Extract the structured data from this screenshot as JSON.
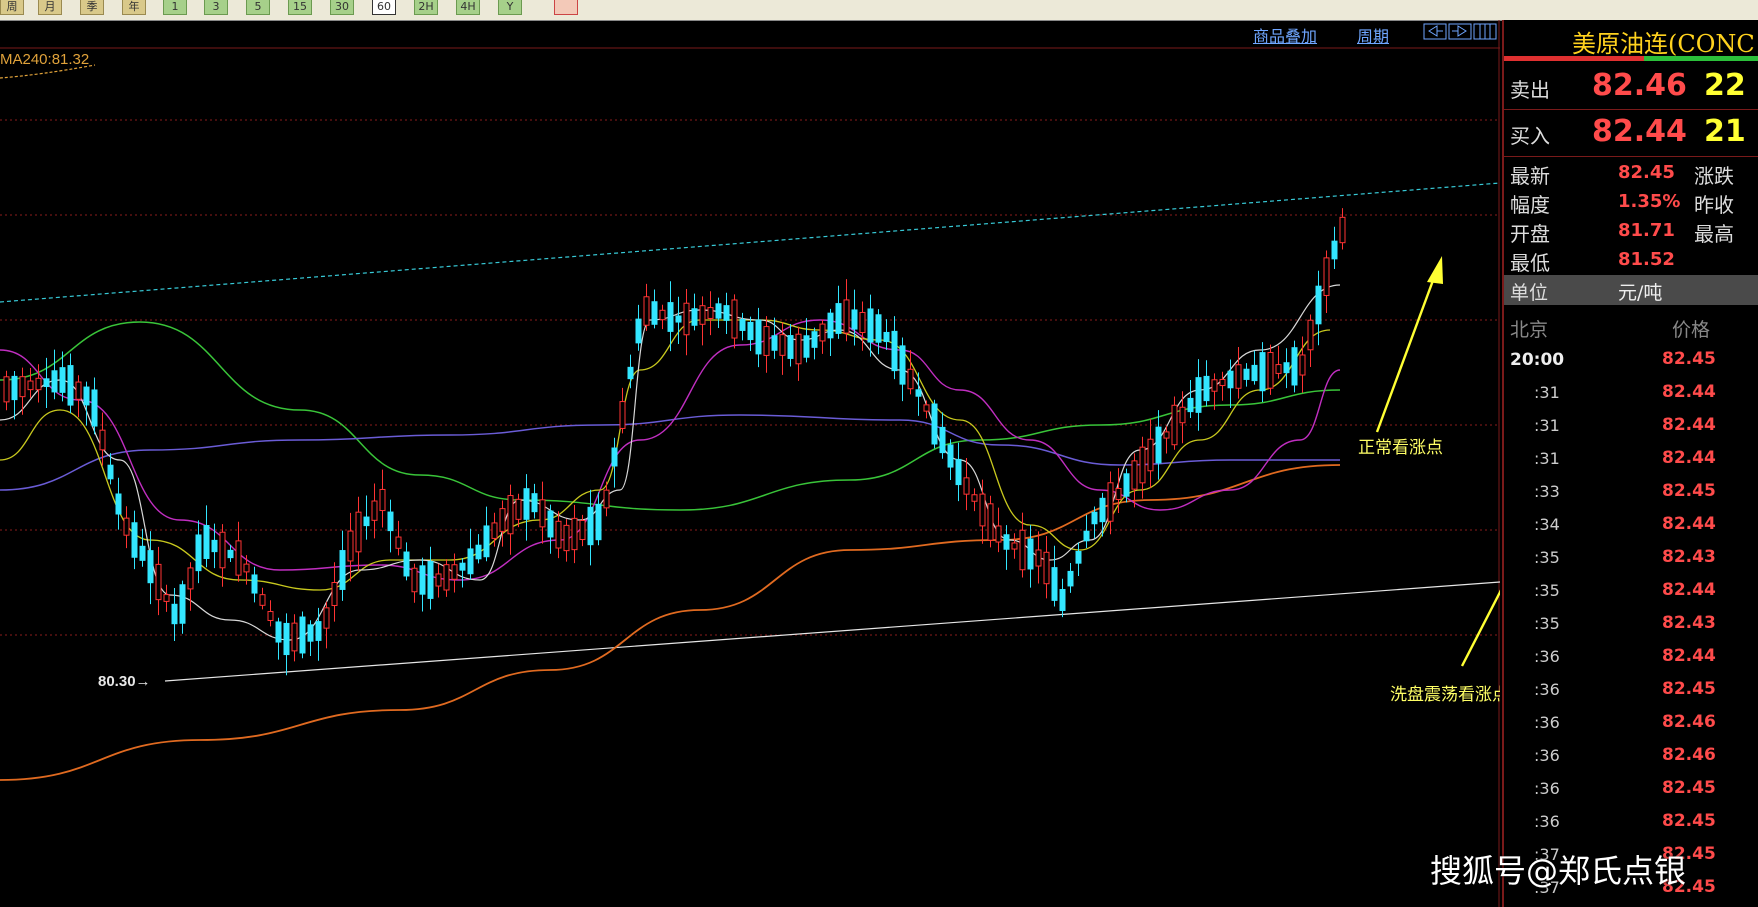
{
  "toolbar": {
    "buttons": [
      "周",
      "月",
      "季",
      "年",
      "1",
      "3",
      "5",
      "15",
      "30",
      "60",
      "2H",
      "4H",
      "Y"
    ],
    "active": "60"
  },
  "chart": {
    "links": {
      "overlay": "商品叠加",
      "period": "周期"
    },
    "ma_label": "MA240:81.32",
    "low_label": "80.30",
    "annotation_normal": "正常看涨点",
    "annotation_wash": "洗盘震荡看涨点",
    "candles_up_color": "#ff3333",
    "candles_down_color": "#33e6ff"
  },
  "chart_data": {
    "type": "candlestick",
    "series": [
      {
        "name": "MA240",
        "value": 81.32
      }
    ],
    "min_marker": 80.3
  },
  "panel": {
    "title": "美原油连(CONC",
    "sell": {
      "label": "卖出",
      "price": "82.46",
      "vol": "22"
    },
    "buy": {
      "label": "买入",
      "price": "82.44",
      "vol": "21"
    },
    "stats": [
      {
        "label": "最新",
        "value": "82.45",
        "label2": "涨跌"
      },
      {
        "label": "幅度",
        "value": "1.35%",
        "label2": "昨收"
      },
      {
        "label": "开盘",
        "value": "81.71",
        "label2": "最高"
      },
      {
        "label": "最低",
        "value": "81.52",
        "label2": ""
      }
    ],
    "unit": {
      "label": "单位",
      "value": "元/吨"
    },
    "ticks_header": {
      "time": "北京",
      "price": "价格"
    },
    "ticks": [
      {
        "t": "20:00",
        "p": "82.45"
      },
      {
        "t": ":31",
        "p": "82.44"
      },
      {
        "t": ":31",
        "p": "82.44"
      },
      {
        "t": ":31",
        "p": "82.44"
      },
      {
        "t": ":33",
        "p": "82.45"
      },
      {
        "t": ":34",
        "p": "82.44"
      },
      {
        "t": ":35",
        "p": "82.43"
      },
      {
        "t": ":35",
        "p": "82.44"
      },
      {
        "t": ":35",
        "p": "82.43"
      },
      {
        "t": ":36",
        "p": "82.44"
      },
      {
        "t": ":36",
        "p": "82.45"
      },
      {
        "t": ":36",
        "p": "82.46"
      },
      {
        "t": ":36",
        "p": "82.46"
      },
      {
        "t": ":36",
        "p": "82.45"
      },
      {
        "t": ":36",
        "p": "82.45"
      },
      {
        "t": ":37",
        "p": "82.45"
      },
      {
        "t": ":37",
        "p": "82.45"
      }
    ]
  },
  "watermark": "搜狐号@郑氏点银"
}
